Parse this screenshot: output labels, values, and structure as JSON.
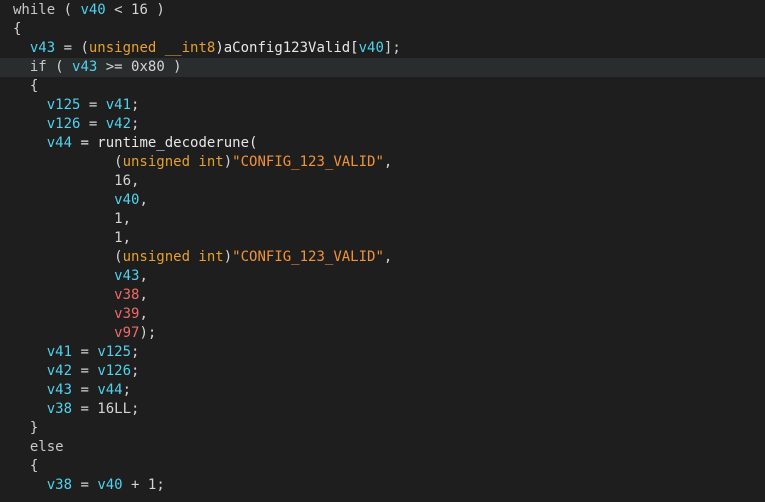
{
  "editor": {
    "colors": {
      "background": "#1e1e1e",
      "current_line": "#2a2d2e",
      "keyword": "#c8c8c8",
      "variable": "#4fd2ec",
      "variable_alt": "#f06a6a",
      "type": "#e5a12b",
      "string": "#f2933a",
      "default": "#d4d4d4"
    },
    "lines": [
      {
        "tokens": [
          {
            "t": "while",
            "c": "kw"
          },
          {
            "t": " ( ",
            "c": "op"
          },
          {
            "t": "v40",
            "c": "var"
          },
          {
            "t": " < 16 )",
            "c": "op"
          }
        ]
      },
      {
        "tokens": [
          {
            "t": "{",
            "c": "op"
          }
        ]
      },
      {
        "tokens": [
          {
            "t": "  ",
            "c": "op"
          },
          {
            "t": "v43",
            "c": "var"
          },
          {
            "t": " = (",
            "c": "op"
          },
          {
            "t": "unsigned __int8",
            "c": "type"
          },
          {
            "t": ")aConfig123Valid[",
            "c": "fn"
          },
          {
            "t": "v40",
            "c": "var"
          },
          {
            "t": "];",
            "c": "op"
          }
        ]
      },
      {
        "current": true,
        "tokens": [
          {
            "t": "  if",
            "c": "kw"
          },
          {
            "t": " ( ",
            "c": "op"
          },
          {
            "t": "v43",
            "c": "var"
          },
          {
            "t": " >= 0x80 )",
            "c": "op"
          }
        ]
      },
      {
        "tokens": [
          {
            "t": "  {",
            "c": "op"
          }
        ]
      },
      {
        "tokens": [
          {
            "t": "    ",
            "c": "op"
          },
          {
            "t": "v125",
            "c": "var"
          },
          {
            "t": " = ",
            "c": "op"
          },
          {
            "t": "v41",
            "c": "var"
          },
          {
            "t": ";",
            "c": "op"
          }
        ]
      },
      {
        "tokens": [
          {
            "t": "    ",
            "c": "op"
          },
          {
            "t": "v126",
            "c": "var"
          },
          {
            "t": " = ",
            "c": "op"
          },
          {
            "t": "v42",
            "c": "var"
          },
          {
            "t": ";",
            "c": "op"
          }
        ]
      },
      {
        "tokens": [
          {
            "t": "    ",
            "c": "op"
          },
          {
            "t": "v44",
            "c": "var"
          },
          {
            "t": " = runtime_decoderune(",
            "c": "fn"
          }
        ]
      },
      {
        "tokens": [
          {
            "t": "            (",
            "c": "op"
          },
          {
            "t": "unsigned int",
            "c": "type"
          },
          {
            "t": ")",
            "c": "op"
          },
          {
            "t": "\"CONFIG_123_VALID\"",
            "c": "str"
          },
          {
            "t": ",",
            "c": "op"
          }
        ]
      },
      {
        "tokens": [
          {
            "t": "            16,",
            "c": "op"
          }
        ]
      },
      {
        "tokens": [
          {
            "t": "            ",
            "c": "op"
          },
          {
            "t": "v40",
            "c": "var"
          },
          {
            "t": ",",
            "c": "op"
          }
        ]
      },
      {
        "tokens": [
          {
            "t": "            1,",
            "c": "op"
          }
        ]
      },
      {
        "tokens": [
          {
            "t": "            1,",
            "c": "op"
          }
        ]
      },
      {
        "tokens": [
          {
            "t": "            (",
            "c": "op"
          },
          {
            "t": "unsigned int",
            "c": "type"
          },
          {
            "t": ")",
            "c": "op"
          },
          {
            "t": "\"CONFIG_123_VALID\"",
            "c": "str"
          },
          {
            "t": ",",
            "c": "op"
          }
        ]
      },
      {
        "tokens": [
          {
            "t": "            ",
            "c": "op"
          },
          {
            "t": "v43",
            "c": "var"
          },
          {
            "t": ",",
            "c": "op"
          }
        ]
      },
      {
        "tokens": [
          {
            "t": "            ",
            "c": "op"
          },
          {
            "t": "v38",
            "c": "var-red"
          },
          {
            "t": ",",
            "c": "op"
          }
        ]
      },
      {
        "tokens": [
          {
            "t": "            ",
            "c": "op"
          },
          {
            "t": "v39",
            "c": "var-red"
          },
          {
            "t": ",",
            "c": "op"
          }
        ]
      },
      {
        "tokens": [
          {
            "t": "            ",
            "c": "op"
          },
          {
            "t": "v97",
            "c": "var-red"
          },
          {
            "t": ");",
            "c": "op"
          }
        ]
      },
      {
        "tokens": [
          {
            "t": "    ",
            "c": "op"
          },
          {
            "t": "v41",
            "c": "var"
          },
          {
            "t": " = ",
            "c": "op"
          },
          {
            "t": "v125",
            "c": "var"
          },
          {
            "t": ";",
            "c": "op"
          }
        ]
      },
      {
        "tokens": [
          {
            "t": "    ",
            "c": "op"
          },
          {
            "t": "v42",
            "c": "var"
          },
          {
            "t": " = ",
            "c": "op"
          },
          {
            "t": "v126",
            "c": "var"
          },
          {
            "t": ";",
            "c": "op"
          }
        ]
      },
      {
        "tokens": [
          {
            "t": "    ",
            "c": "op"
          },
          {
            "t": "v43",
            "c": "var"
          },
          {
            "t": " = ",
            "c": "op"
          },
          {
            "t": "v44",
            "c": "var"
          },
          {
            "t": ";",
            "c": "op"
          }
        ]
      },
      {
        "tokens": [
          {
            "t": "    ",
            "c": "op"
          },
          {
            "t": "v38",
            "c": "var"
          },
          {
            "t": " = 16LL;",
            "c": "op"
          }
        ]
      },
      {
        "tokens": [
          {
            "t": "  }",
            "c": "op"
          }
        ]
      },
      {
        "tokens": [
          {
            "t": "  else",
            "c": "kw"
          }
        ]
      },
      {
        "tokens": [
          {
            "t": "  {",
            "c": "op"
          }
        ]
      },
      {
        "tokens": [
          {
            "t": "    ",
            "c": "op"
          },
          {
            "t": "v38",
            "c": "var"
          },
          {
            "t": " = ",
            "c": "op"
          },
          {
            "t": "v40",
            "c": "var"
          },
          {
            "t": " + 1;",
            "c": "op"
          }
        ]
      }
    ]
  }
}
